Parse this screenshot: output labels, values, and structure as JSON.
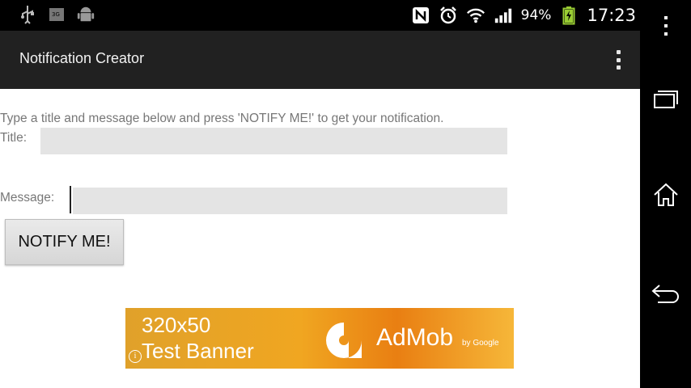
{
  "statusbar": {
    "left_icons": [
      "usb-icon",
      "3g-sim-icon",
      "android-icon"
    ],
    "right_icons": [
      "nfc-icon",
      "alarm-icon",
      "wifi-icon",
      "signal-icon",
      "battery-charging-icon"
    ],
    "battery_percent": "94%",
    "time": "17:23"
  },
  "app": {
    "title": "Notification Creator",
    "menu_icon": "overflow-menu-icon",
    "instructions": "Type a title and message below and press 'NOTIFY ME!' to get your notification.",
    "title_label": "Title:",
    "title_value": "",
    "message_label": "Message:",
    "message_value": "",
    "notify_button": "NOTIFY ME!"
  },
  "banner": {
    "line1": "320x50",
    "line2": "Test Banner",
    "brand": "AdMob",
    "brand_sub": "by Google",
    "info_glyph": "i",
    "colors": {
      "start": "#e0a12a",
      "end": "#f6b739"
    }
  },
  "navbar": {
    "buttons": [
      "recent-apps-icon",
      "home-icon",
      "back-icon"
    ]
  },
  "colors": {
    "actionbar": "#212121",
    "field": "#e4e4e4",
    "text_muted": "#777777"
  }
}
